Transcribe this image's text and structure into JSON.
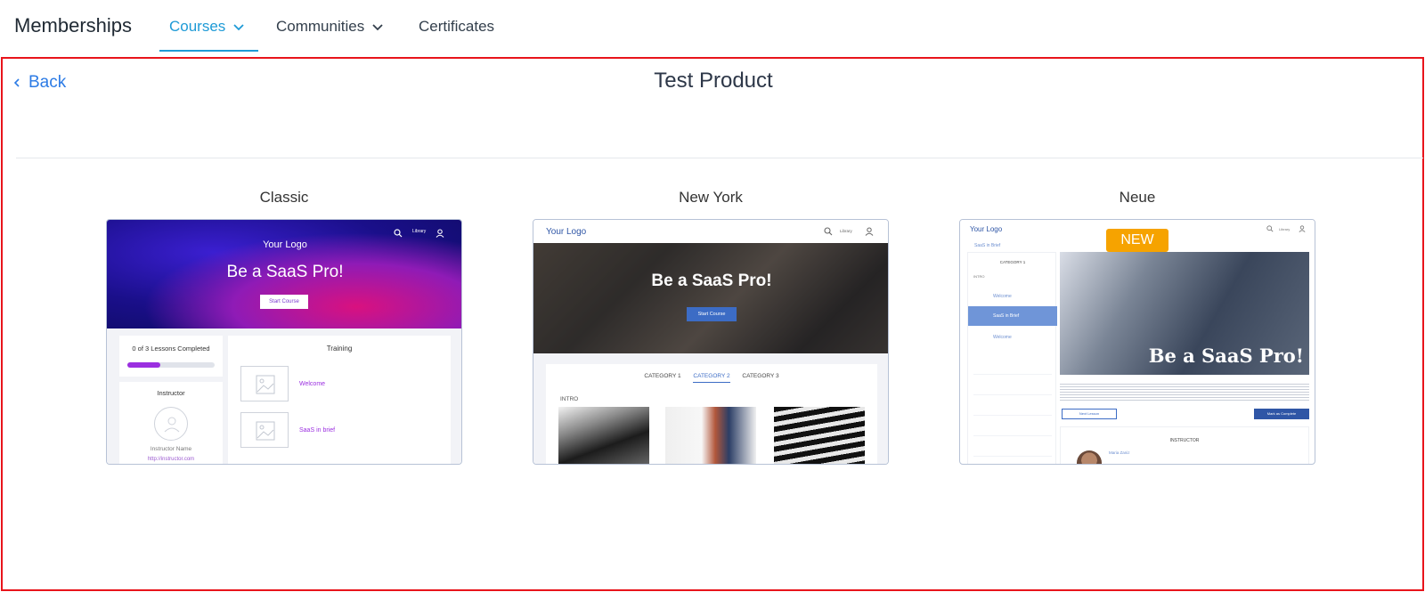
{
  "nav": {
    "brand": "Memberships",
    "tabs": [
      {
        "label": "Courses",
        "active": true
      },
      {
        "label": "Communities",
        "active": false
      },
      {
        "label": "Certificates",
        "active": false
      }
    ]
  },
  "page": {
    "back_label": "Back",
    "title": "Test Product"
  },
  "themes": [
    {
      "name": "Classic",
      "preview": {
        "logo": "Your Logo",
        "headline": "Be a SaaS Pro!",
        "button": "Start Course",
        "nav_text": "Library",
        "progress_text": "0 of 3 Lessons Completed",
        "progress_fraction": 0.38,
        "instructor_heading": "Instructor",
        "instructor_name": "Instructor Name",
        "instructor_url": "http://instructor.com",
        "training_heading": "Training",
        "lessons": [
          "Welcome",
          "SaaS in brief"
        ]
      }
    },
    {
      "name": "New York",
      "preview": {
        "logo": "Your Logo",
        "nav_text": "Library",
        "headline": "Be a SaaS Pro!",
        "button": "Start Course",
        "categories": [
          "CATEGORY 1",
          "CATEGORY 2",
          "CATEGORY 3"
        ],
        "active_category": "CATEGORY 2",
        "section": "INTRO"
      }
    },
    {
      "name": "Neue",
      "badge": "NEW",
      "preview": {
        "logo": "Your Logo",
        "nav_text": "Library",
        "breadcrumb": "SaaS in Brief",
        "category": "CATEGORY 1",
        "intro": "INTRO",
        "lessons": [
          "Welcome",
          "SaaS in Brief",
          "Welcome"
        ],
        "headline": "Be a SaaS Pro!",
        "prev_button": "Next Lesson",
        "complete_button": "Mark as Complete",
        "instructor_heading": "INSTRUCTOR",
        "instructor_name": "Maria Zaniz"
      }
    }
  ],
  "colors": {
    "accent": "#1e9ad6",
    "link": "#2c7be5",
    "frame_border": "#e8141b",
    "badge": "#f6a300"
  }
}
